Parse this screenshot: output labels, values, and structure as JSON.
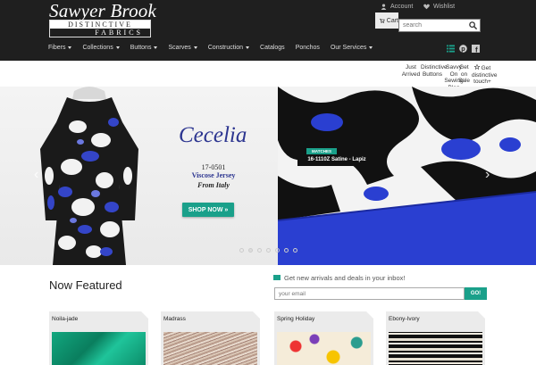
{
  "brand": {
    "title_top": "Sawyer Brook",
    "title_line1": "DISTINCTIVE",
    "title_line2": "FABRICS"
  },
  "utility": {
    "account": "Account",
    "wishlist": "Wishlist",
    "cart": "Cart",
    "search_placeholder": "search"
  },
  "nav": {
    "items": [
      {
        "label": "Fibers",
        "caret": true
      },
      {
        "label": "Collections",
        "caret": true
      },
      {
        "label": "Buttons",
        "caret": true
      },
      {
        "label": "Scarves",
        "caret": true
      },
      {
        "label": "Construction",
        "caret": true
      },
      {
        "label": "Catalogs",
        "caret": false
      },
      {
        "label": "Ponchos",
        "caret": false
      },
      {
        "label": "Our Services",
        "caret": true
      }
    ]
  },
  "subnav": {
    "just_arrived": "Just Arrived",
    "distinctive_buttons": "Distinctive Buttons",
    "savvy_blog": "Savvy On Sewing Blog",
    "get_on_sale": "Get on Sale",
    "distinctive_touch": "Get distinctive touch+"
  },
  "hero": {
    "title": "Cecelia",
    "code": "17-0501",
    "fabric": "Viscose Jersey",
    "origin": "From Italy",
    "cta": "SHOP NOW »",
    "matches_tag": "MATCHES WITH",
    "matches_item": "16-1110Z Satine - Lapiz",
    "slide_count": 7,
    "active_slide": 2
  },
  "featured": {
    "title": "Now Featured"
  },
  "newsletter": {
    "text": "Get new arrivals and deals in your inbox!",
    "placeholder": "your email",
    "button": "GO!"
  },
  "products": [
    {
      "name": "Noila-jade"
    },
    {
      "name": "Madrass"
    },
    {
      "name": "Spring Holiday"
    },
    {
      "name": "Ebony-Ivory"
    }
  ],
  "colors": {
    "accent": "#1aa08a",
    "header_bg": "#1f1f1f",
    "hero_blue": "#2a3fd1"
  },
  "icons": {
    "account": "person-icon",
    "wishlist": "heart-icon",
    "cart": "cart-icon",
    "search": "search-icon",
    "list": "list-icon",
    "pinterest": "pinterest-icon",
    "facebook": "facebook-icon"
  }
}
